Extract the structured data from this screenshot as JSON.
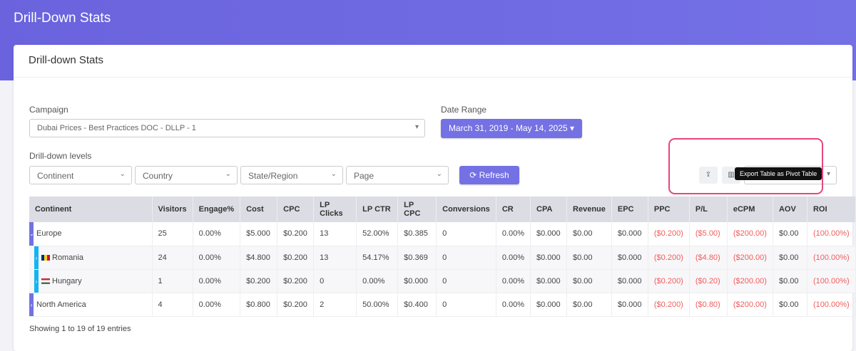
{
  "header": {
    "title": "Drill-Down Stats"
  },
  "card": {
    "title": "Drill-down Stats"
  },
  "campaign": {
    "label": "Campaign",
    "value": "Dubai Prices - Best Practices DOC  -  DLLP  -  1"
  },
  "date_range": {
    "label": "Date Range",
    "value": "March 31, 2019 - May 14, 2025 ▾"
  },
  "drilldown": {
    "label": "Drill-down levels",
    "levels": [
      "Continent",
      "Country",
      "State/Region",
      "Page"
    ]
  },
  "refresh_label": "⟳ Refresh",
  "tooltip": "Export Table as Pivot Table",
  "colors": {
    "accent": "#7371e3",
    "child": "#14b4f0",
    "negative": "#f25c5c",
    "highlight": "#e8457a"
  },
  "table": {
    "columns": [
      "Continent",
      "Visitors",
      "Engage%",
      "Cost",
      "CPC",
      "LP Clicks",
      "LP CTR",
      "LP CPC",
      "Conversions",
      "CR",
      "CPA",
      "Revenue",
      "EPC",
      "PPC",
      "P/L",
      "eCPM",
      "AOV",
      "ROI"
    ],
    "rows": [
      {
        "level": 0,
        "expanded": true,
        "cells": [
          "Europe",
          "25",
          "0.00%",
          "$5.000",
          "$0.200",
          "13",
          "52.00%",
          "$0.385",
          "0",
          "0.00%",
          "$0.000",
          "$0.00",
          "$0.000",
          "($0.200)",
          "($5.00)",
          "($200.00)",
          "$0.00",
          "(100.00%)"
        ]
      },
      {
        "level": 1,
        "flag": "romania",
        "cells": [
          "Romania",
          "24",
          "0.00%",
          "$4.800",
          "$0.200",
          "13",
          "54.17%",
          "$0.369",
          "0",
          "0.00%",
          "$0.000",
          "$0.00",
          "$0.000",
          "($0.200)",
          "($4.80)",
          "($200.00)",
          "$0.00",
          "(100.00%)"
        ]
      },
      {
        "level": 1,
        "flag": "hungary",
        "cells": [
          "Hungary",
          "1",
          "0.00%",
          "$0.200",
          "$0.200",
          "0",
          "0.00%",
          "$0.000",
          "0",
          "0.00%",
          "$0.000",
          "$0.00",
          "$0.000",
          "($0.200)",
          "($0.20)",
          "($200.00)",
          "$0.00",
          "(100.00%)"
        ]
      },
      {
        "level": 0,
        "expanded": false,
        "cells": [
          "North America",
          "4",
          "0.00%",
          "$0.800",
          "$0.200",
          "2",
          "50.00%",
          "$0.400",
          "0",
          "0.00%",
          "$0.000",
          "$0.00",
          "$0.000",
          "($0.200)",
          "($0.80)",
          "($200.00)",
          "$0.00",
          "(100.00%)"
        ]
      }
    ]
  },
  "footer": "Showing 1 to 19 of 19 entries"
}
